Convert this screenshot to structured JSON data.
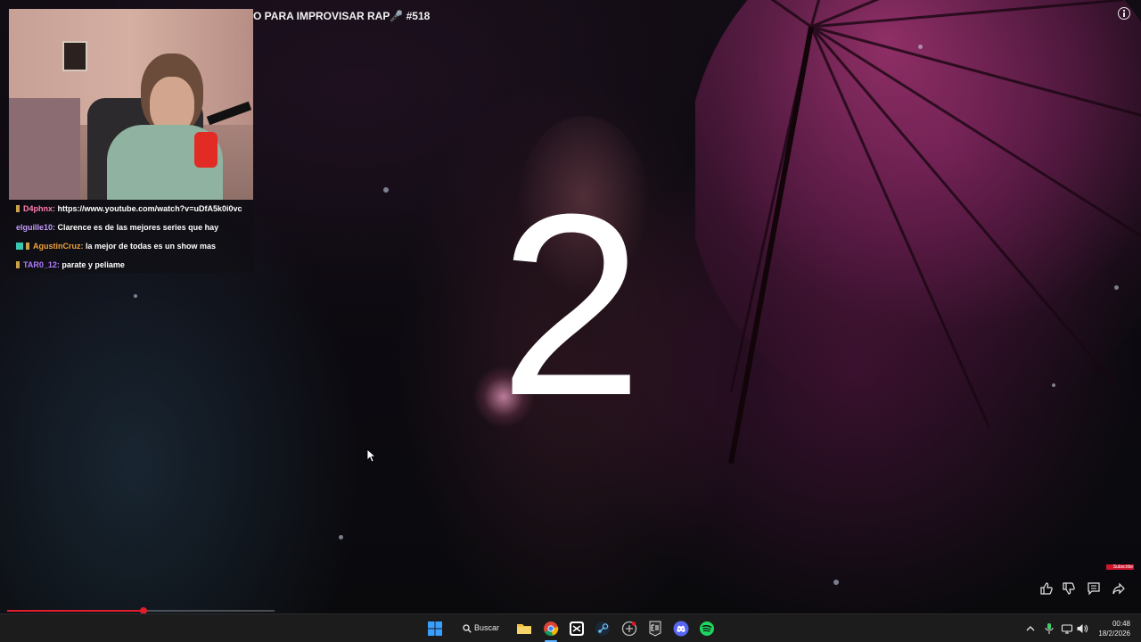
{
  "video": {
    "title": "O PARA IMPROVISAR RAP🎤 #518",
    "countdown": "2",
    "progress_fraction": 0.51
  },
  "chat": {
    "messages": [
      {
        "user": "D4phnx:",
        "text": "https://www.youtube.com/watch?v=uDfA5k0i0vc",
        "user_color": "#ff7eb0"
      },
      {
        "user": "elguille10:",
        "text": "Clarence es de las mejores series que hay",
        "user_color": "#c79bff"
      },
      {
        "user": "AgustinCruz:",
        "text": "la mejor de todas es un show mas",
        "user_color": "#f0a23a"
      },
      {
        "user": "TAR0_12:",
        "text": "parate y peliame",
        "user_color": "#b07cff"
      }
    ]
  },
  "overlay": {
    "subscribe_label": "Subscribe"
  },
  "taskbar": {
    "search_label": "Buscar",
    "time": "00:48",
    "date": "18/2/2026"
  }
}
